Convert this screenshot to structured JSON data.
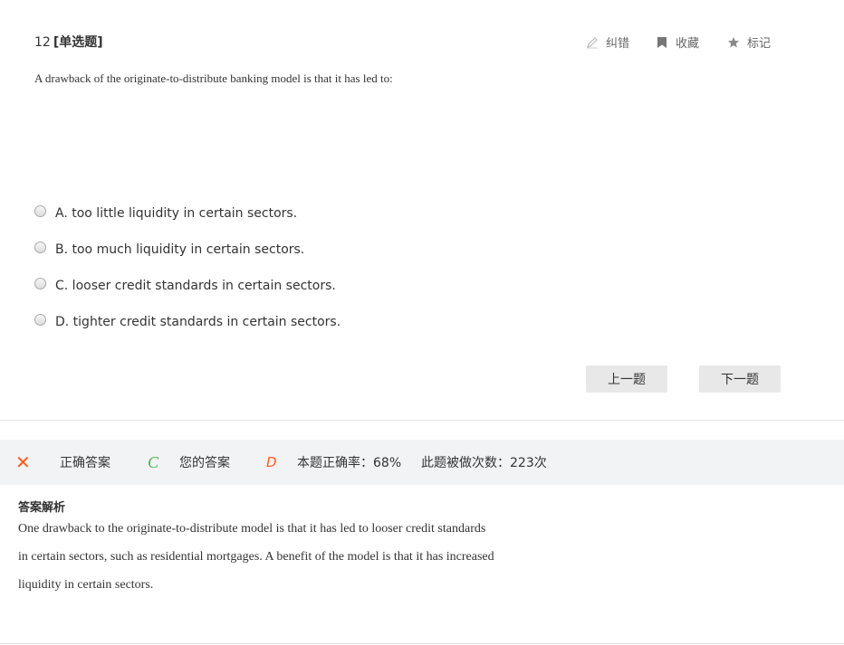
{
  "question": {
    "number": "12",
    "type": "[单选题]",
    "text": "A drawback of the originate-to-distribute banking model is that it has led to:"
  },
  "tools": {
    "fix": {
      "label": "纠错",
      "icon": "pencil-icon"
    },
    "favorite": {
      "label": "收藏",
      "icon": "bookmark-icon"
    },
    "mark": {
      "label": "标记",
      "icon": "star-icon"
    }
  },
  "options": [
    {
      "label": "A. too little liquidity in certain sectors."
    },
    {
      "label": "B. too much liquidity in certain sectors."
    },
    {
      "label": "C. looser credit standards in certain sectors."
    },
    {
      "label": "D. tighter credit standards in certain sectors."
    }
  ],
  "nav": {
    "prev": "上一题",
    "next": "下一题"
  },
  "answer": {
    "correct_letter": "✕",
    "correct_label": "正确答案",
    "your_letter": "C",
    "your_label": "您的答案",
    "d_letter": "D",
    "accuracy": "本题正确率：68%",
    "attempts": "此题被做次数：223次"
  },
  "explanation": {
    "title": "答案解析",
    "lines": [
      "One drawback to the originate-to-distribute model is that it has led to looser credit standards",
      "in certain sectors, such as residential mortgages. A benefit of the model is that it has increased",
      "liquidity in certain sectors."
    ]
  },
  "colors": {
    "accent_orange": "#ff5a1f",
    "accent_green": "#4caf50",
    "button_bg": "#e8e8e8",
    "bar_bg": "#f2f3f5"
  }
}
